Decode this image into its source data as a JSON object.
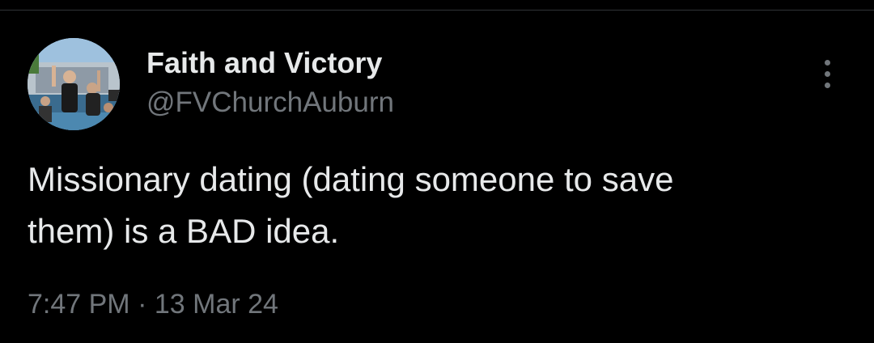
{
  "tweet": {
    "author": {
      "display_name": "Faith and Victory",
      "handle": "@FVChurchAuburn",
      "avatar_icon": "profile-photo"
    },
    "text_line1": "Missionary dating (dating someone to save",
    "text_line2": "them) is a BAD idea.",
    "time": "7:47 PM",
    "separator": "·",
    "date": "13 Mar 24",
    "more_icon": "more-vertical-icon"
  },
  "colors": {
    "background": "#000000",
    "primary_text": "#e7e9ea",
    "secondary_text": "#71767b",
    "divider": "#2f3336"
  }
}
